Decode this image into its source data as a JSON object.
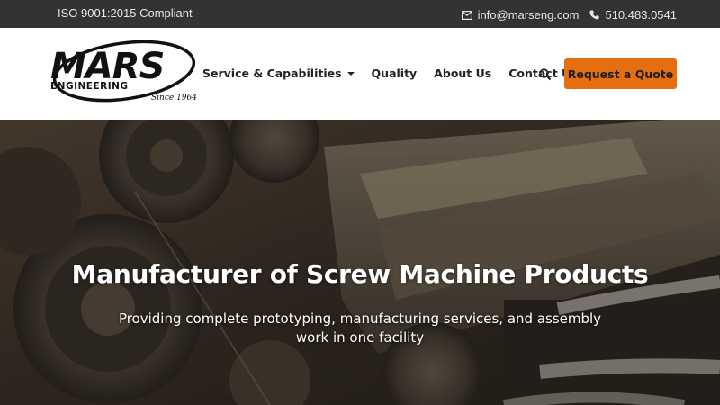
{
  "topbar": {
    "certification": "ISO 9001:2015 Compliant",
    "email": "info@marseng.com",
    "phone": "510.483.0541",
    "icons": [
      "envelope-icon",
      "phone-icon"
    ]
  },
  "logo": {
    "wordmark": "MARS",
    "subtitle": "ENGINEERING",
    "tagline": "Since 1964"
  },
  "nav": {
    "items": [
      {
        "label": "Service & Capabilities",
        "has_dropdown": true
      },
      {
        "label": "Quality",
        "has_dropdown": false
      },
      {
        "label": "About Us",
        "has_dropdown": false
      },
      {
        "label": "Contact Us",
        "has_dropdown": false
      }
    ],
    "search_icon": "search-icon",
    "cta_label": "Request a Quote"
  },
  "hero": {
    "title": "Manufacturer of Screw Machine Products",
    "subtitle": "Providing complete prototyping, manufacturing services, and assembly work in one facility"
  },
  "colors": {
    "topbar_bg": "#333333",
    "accent": "#e56f10",
    "nav_text": "#222222",
    "hero_text": "#ffffff"
  }
}
